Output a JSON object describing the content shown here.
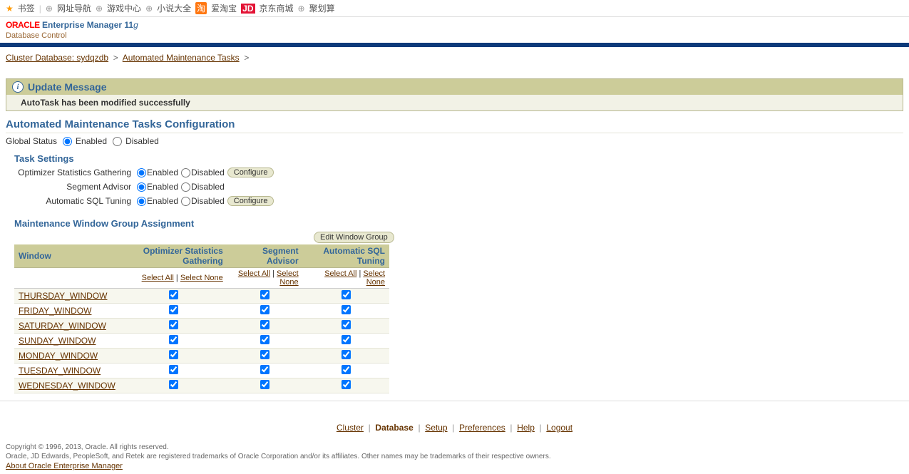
{
  "bookmarks": {
    "star": "书签",
    "items": [
      "网址导航",
      "游戏中心",
      "小说大全",
      "爱淘宝",
      "京东商城",
      "聚划算"
    ]
  },
  "brand": {
    "oracle": "ORACLE",
    "em": "Enterprise Manager 11",
    "g": "g",
    "db_control": "Database Control"
  },
  "crumbs": {
    "cluster": "Cluster Database: sydqzdb",
    "amt": "Automated Maintenance Tasks",
    "sep": ">"
  },
  "update": {
    "title": "Update Message",
    "text": "AutoTask has been modified successfully"
  },
  "page_title": "Automated Maintenance Tasks Configuration",
  "global_status": {
    "label": "Global Status",
    "enabled": "Enabled",
    "disabled": "Disabled"
  },
  "task_settings": {
    "title": "Task Settings",
    "rows": [
      {
        "label": "Optimizer Statistics Gathering",
        "enabled": "Enabled",
        "disabled": "Disabled",
        "cfg": "Configure"
      },
      {
        "label": "Segment Advisor",
        "enabled": "Enabled",
        "disabled": "Disabled",
        "cfg": null
      },
      {
        "label": "Automatic SQL Tuning",
        "enabled": "Enabled",
        "disabled": "Disabled",
        "cfg": "Configure"
      }
    ]
  },
  "mw": {
    "title": "Maintenance Window Group Assignment",
    "edit_btn": "Edit Window Group",
    "cols": [
      "Window",
      "Optimizer Statistics Gathering",
      "Segment Advisor",
      "Automatic SQL Tuning"
    ],
    "select_all": "Select All",
    "select_none": "Select None",
    "windows": [
      "THURSDAY_WINDOW",
      "FRIDAY_WINDOW",
      "SATURDAY_WINDOW",
      "SUNDAY_WINDOW",
      "MONDAY_WINDOW",
      "TUESDAY_WINDOW",
      "WEDNESDAY_WINDOW"
    ]
  },
  "footer": {
    "links": [
      "Cluster",
      "Database",
      "Setup",
      "Preferences",
      "Help",
      "Logout"
    ],
    "copyright": "Copyright © 1996, 2013, Oracle. All rights reserved.",
    "tm": "Oracle, JD Edwards, PeopleSoft, and Retek are registered trademarks of Oracle Corporation and/or its affiliates. Other names may be trademarks of their respective owners.",
    "about": "About Oracle Enterprise Manager"
  }
}
